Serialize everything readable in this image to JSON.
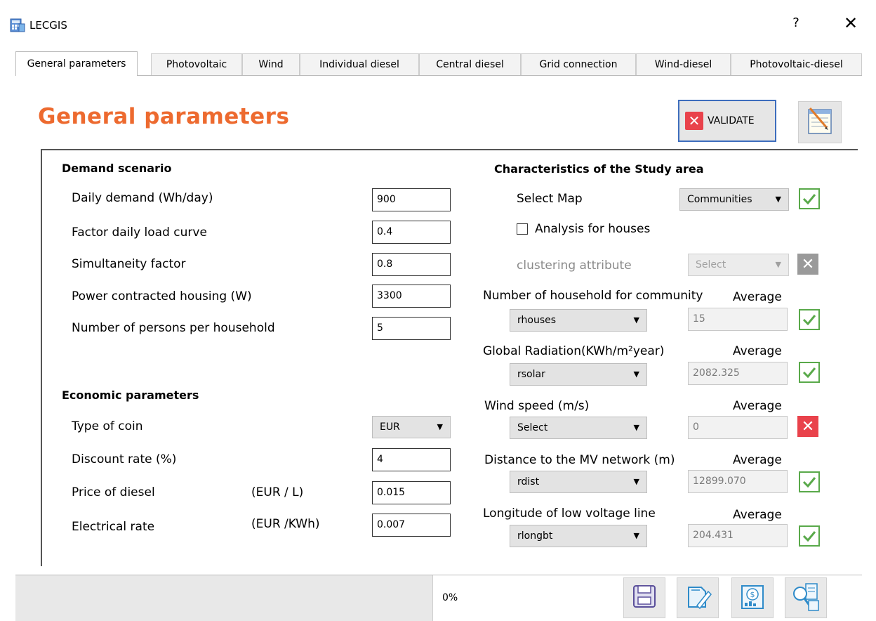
{
  "window": {
    "title": "LECGIS",
    "help_label": "?",
    "close_label": "✕"
  },
  "tabs": [
    {
      "label": "General parameters"
    },
    {
      "label": "Photovoltaic"
    },
    {
      "label": "Wind"
    },
    {
      "label": "Individual diesel"
    },
    {
      "label": "Central diesel"
    },
    {
      "label": "Grid connection"
    },
    {
      "label": "Wind-diesel"
    },
    {
      "label": "Photovoltaic-diesel"
    }
  ],
  "page": {
    "title": "General parameters",
    "validate_label": "VALIDATE"
  },
  "demand": {
    "heading": "Demand scenario",
    "fields": [
      {
        "label": "Daily demand (Wh/day)",
        "value": "900"
      },
      {
        "label": "Factor daily load curve",
        "value": "0.4"
      },
      {
        "label": "Simultaneity factor",
        "value": "0.8"
      },
      {
        "label": "Power contracted housing (W)",
        "value": "3300"
      },
      {
        "label": "Number of persons per household",
        "value": "5"
      }
    ]
  },
  "economic": {
    "heading": "Economic parameters",
    "coin_label": "Type of coin",
    "coin_value": "EUR",
    "discount_label": "Discount rate (%)",
    "discount_value": "4",
    "diesel_label": "Price of diesel",
    "diesel_unit": "(EUR / L)",
    "diesel_value": "0.015",
    "elec_label": "Electrical rate",
    "elec_unit": "(EUR /KWh)",
    "elec_value": "0.007"
  },
  "study": {
    "heading": "Characteristics of the Study area",
    "select_map_label": "Select Map",
    "select_map_value": "Communities",
    "analysis_label": "Analysis for houses",
    "analysis_checked": false,
    "cluster_label": "clustering attribute",
    "cluster_value": "Select",
    "average_label": "Average",
    "rows": [
      {
        "label": "Number of household for community",
        "combo": "rhouses",
        "average": "15",
        "status": "ok"
      },
      {
        "label": "Global Radiation(KWh/m²year)",
        "combo": "rsolar",
        "average": "2082.325",
        "status": "ok"
      },
      {
        "label": "Wind speed (m/s)",
        "combo": "Select",
        "average": "0",
        "status": "error"
      },
      {
        "label": "Distance to the MV network (m)",
        "combo": "rdist",
        "average": "12899.070",
        "status": "ok"
      },
      {
        "label": "Longitude of low voltage line",
        "combo": "rlongbt",
        "average": "204.431",
        "status": "ok"
      }
    ]
  },
  "status": {
    "progress_text": "0%",
    "progress_value": 0
  },
  "colors": {
    "accent": "#ed6a2f",
    "ok": "#59a94a",
    "error": "#e9424b",
    "focus": "#3d6dbd"
  },
  "icons": [
    "app-icon",
    "notepad-icon",
    "save-icon",
    "edit-document-icon",
    "cost-report-icon",
    "search-report-icon"
  ]
}
